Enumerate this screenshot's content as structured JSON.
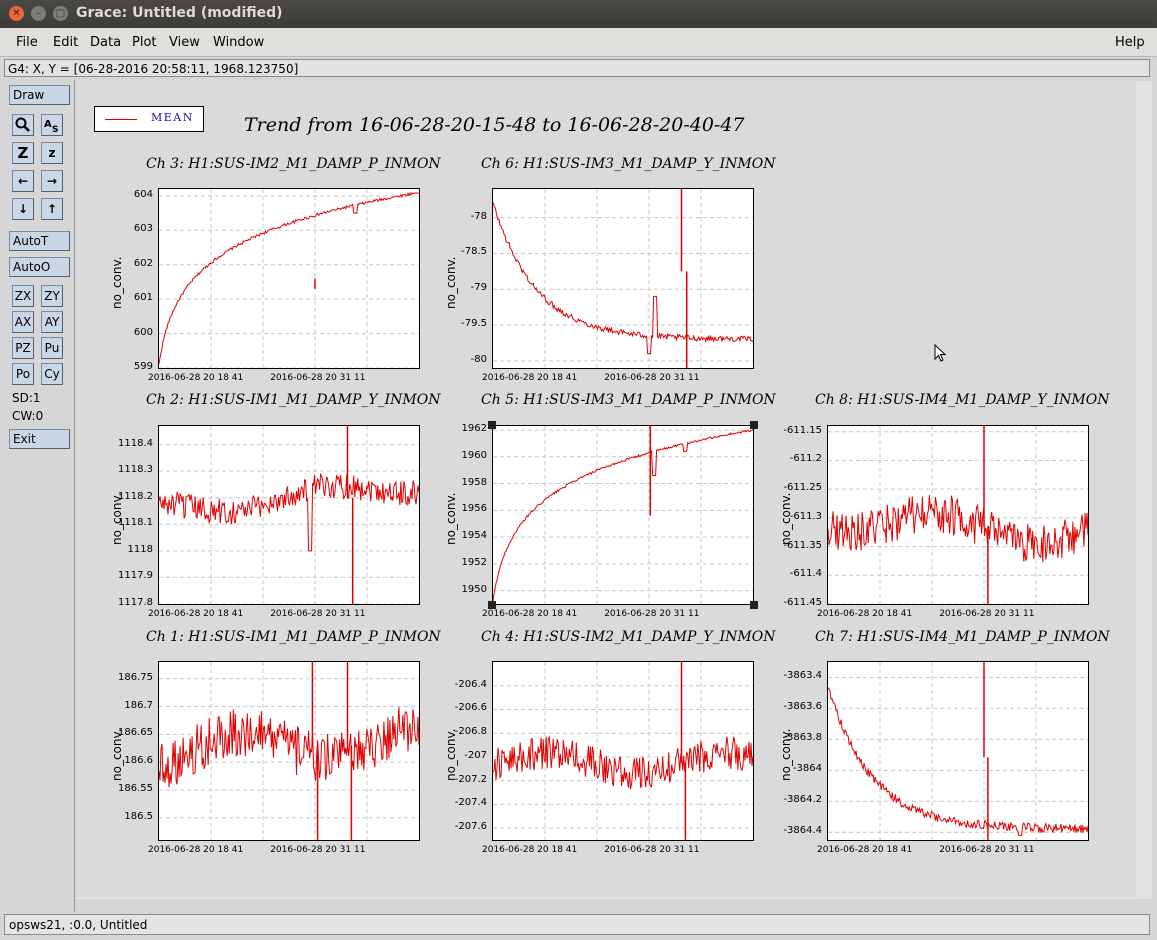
{
  "window": {
    "title": "Grace: Untitled (modified)"
  },
  "menu": {
    "file": "File",
    "edit": "Edit",
    "data": "Data",
    "plot": "Plot",
    "view": "View",
    "window": "Window",
    "help": "Help"
  },
  "locator": "G4: X, Y = [06-28-2016 20:58:11, 1968.123750]",
  "toolbar": {
    "draw": "Draw",
    "autot": "AutoT",
    "autoo": "AutoO",
    "zx": "ZX",
    "zy": "ZY",
    "ax": "AX",
    "ay": "AY",
    "pz": "PZ",
    "pu": "Pu",
    "po": "Po",
    "cy": "Cy",
    "sd": "SD:1",
    "cw": "CW:0",
    "exit": "Exit"
  },
  "status": "opsws21, :0.0, Untitled",
  "legend": {
    "label": "MEAN",
    "color": "#e00000"
  },
  "figure_title": "Trend from 16-06-28-20-15-48 to 16-06-28-20-40-47",
  "chart_data": [
    {
      "type": "line",
      "title": "Ch 3: H1:SUS-IM2_M1_DAMP_P_INMON",
      "ylabel": "no_conv.",
      "x_ticks": [
        "2016-06-28 20 18 41",
        "2016-06-28 20 31 11"
      ],
      "y_ticks": [
        "599",
        "600",
        "601",
        "602",
        "603",
        "604"
      ],
      "ylim": [
        599,
        604.2
      ],
      "trend": "log-rise",
      "start": 599.1,
      "end": 604.1,
      "noise": 0.04,
      "spikes": [
        {
          "t": 0.6,
          "v": 601.3
        }
      ],
      "dips": [
        {
          "t": 0.755,
          "v": 603.5
        }
      ],
      "series": [
        {
          "name": "MEAN",
          "color": "#e00000"
        }
      ]
    },
    {
      "type": "line",
      "title": "Ch 6: H1:SUS-IM3_M1_DAMP_Y_INMON",
      "ylabel": "no_conv.",
      "x_ticks": [
        "2016-06-28 20 18 41",
        "2016-06-28 20 31 11"
      ],
      "y_ticks": [
        "-78",
        "-78.5",
        "-79",
        "-79.5",
        "-80"
      ],
      "ylim": [
        -80.1,
        -77.6
      ],
      "trend": "exp-decay",
      "start": -77.8,
      "end": -79.7,
      "noise": 0.04,
      "spikes": [
        {
          "t": 0.725,
          "v": -77.6
        },
        {
          "t": 0.745,
          "v": -80.1
        }
      ],
      "dips": [
        {
          "t": 0.6,
          "v": -79.9
        },
        {
          "t": 0.625,
          "v": -79.1
        }
      ],
      "series": [
        {
          "name": "MEAN",
          "color": "#e00000"
        }
      ]
    },
    {
      "type": "line",
      "title": "Ch 2: H1:SUS-IM1_M1_DAMP_Y_INMON",
      "ylabel": "no_conv.",
      "x_ticks": [
        "2016-06-28 20 18 41",
        "2016-06-28 20 31 11"
      ],
      "y_ticks": [
        "1117.8",
        "1117.9",
        "1118",
        "1118.1",
        "1118.2",
        "1118.3",
        "1118.4"
      ],
      "ylim": [
        1117.8,
        1118.47
      ],
      "trend": "noisy-flat",
      "start": 1118.15,
      "end": 1118.25,
      "noise": 0.05,
      "spikes": [
        {
          "t": 0.725,
          "v": 1118.47
        },
        {
          "t": 0.745,
          "v": 1117.8
        }
      ],
      "dips": [
        {
          "t": 0.58,
          "v": 1118.0
        }
      ],
      "series": [
        {
          "name": "MEAN",
          "color": "#e00000"
        }
      ]
    },
    {
      "type": "line",
      "title": "Ch 5: H1:SUS-IM3_M1_DAMP_P_INMON",
      "ylabel": "no_conv.",
      "x_ticks": [
        "2016-06-28 20 18 41",
        "2016-06-28 20 31 11"
      ],
      "y_ticks": [
        "1950",
        "1952",
        "1954",
        "1956",
        "1958",
        "1960",
        "1962"
      ],
      "ylim": [
        1949,
        1962.3
      ],
      "trend": "log-rise",
      "start": 1949.2,
      "end": 1962.0,
      "noise": 0.08,
      "spikes": [
        {
          "t": 0.605,
          "v": 1962.3
        }
      ],
      "dips": [
        {
          "t": 0.62,
          "v": 1958.6
        },
        {
          "t": 0.74,
          "v": 1960.4
        }
      ],
      "series": [
        {
          "name": "MEAN",
          "color": "#e00000"
        }
      ]
    },
    {
      "type": "line",
      "title": "Ch 8: H1:SUS-IM4_M1_DAMP_Y_INMON",
      "ylabel": "no_conv.",
      "x_ticks": [
        "2016-06-28 20 18 41",
        "2016-06-28 20 31 11"
      ],
      "y_ticks": [
        "-611.15",
        "-611.2",
        "-611.25",
        "-611.3",
        "-611.35",
        "-611.4",
        "-611.45"
      ],
      "ylim": [
        -611.45,
        -611.14
      ],
      "trend": "noisy-flat",
      "start": -611.3,
      "end": -611.33,
      "noise": 0.035,
      "spikes": [
        {
          "t": 0.6,
          "v": -611.14
        },
        {
          "t": 0.615,
          "v": -611.45
        }
      ],
      "dips": [],
      "series": [
        {
          "name": "MEAN",
          "color": "#e00000"
        }
      ]
    },
    {
      "type": "line",
      "title": "Ch 1: H1:SUS-IM1_M1_DAMP_P_INMON",
      "ylabel": "no_conv.",
      "x_ticks": [
        "2016-06-28 20 18 41",
        "2016-06-28 20 31 11"
      ],
      "y_ticks": [
        "186.5",
        "186.55",
        "186.6",
        "186.65",
        "186.7",
        "186.75"
      ],
      "ylim": [
        186.46,
        186.78
      ],
      "trend": "noisy-flat",
      "start": 186.62,
      "end": 186.64,
      "noise": 0.045,
      "spikes": [
        {
          "t": 0.59,
          "v": 186.78
        },
        {
          "t": 0.61,
          "v": 186.46
        },
        {
          "t": 0.725,
          "v": 186.78
        },
        {
          "t": 0.74,
          "v": 186.46
        }
      ],
      "dips": [],
      "series": [
        {
          "name": "MEAN",
          "color": "#e00000"
        }
      ]
    },
    {
      "type": "line",
      "title": "Ch 4: H1:SUS-IM2_M1_DAMP_Y_INMON",
      "ylabel": "no_conv.",
      "x_ticks": [
        "2016-06-28 20 18 41",
        "2016-06-28 20 31 11"
      ],
      "y_ticks": [
        "-206.4",
        "-206.6",
        "-206.8",
        "-207",
        "-207.2",
        "-207.4",
        "-207.6"
      ],
      "ylim": [
        -207.7,
        -206.2
      ],
      "trend": "noisy-flat",
      "start": -207.05,
      "end": -207.05,
      "noise": 0.14,
      "spikes": [
        {
          "t": 0.725,
          "v": -206.2
        },
        {
          "t": 0.74,
          "v": -207.7
        }
      ],
      "dips": [],
      "series": [
        {
          "name": "MEAN",
          "color": "#e00000"
        }
      ]
    },
    {
      "type": "line",
      "title": "Ch 7: H1:SUS-IM4_M1_DAMP_P_INMON",
      "ylabel": "no_conv.",
      "x_ticks": [
        "2016-06-28 20 18 41",
        "2016-06-28 20 31 11"
      ],
      "y_ticks": [
        "-3863.4",
        "-3863.6",
        "-3863.8",
        "-3864",
        "-3864.2",
        "-3864.4"
      ],
      "ylim": [
        -3864.45,
        -3863.3
      ],
      "trend": "exp-decay",
      "start": -3863.45,
      "end": -3864.38,
      "noise": 0.03,
      "spikes": [
        {
          "t": 0.6,
          "v": -3863.3
        },
        {
          "t": 0.615,
          "v": -3864.45
        }
      ],
      "dips": [
        {
          "t": 0.74,
          "v": -3864.42
        }
      ],
      "series": [
        {
          "name": "MEAN",
          "color": "#e00000"
        }
      ]
    }
  ]
}
